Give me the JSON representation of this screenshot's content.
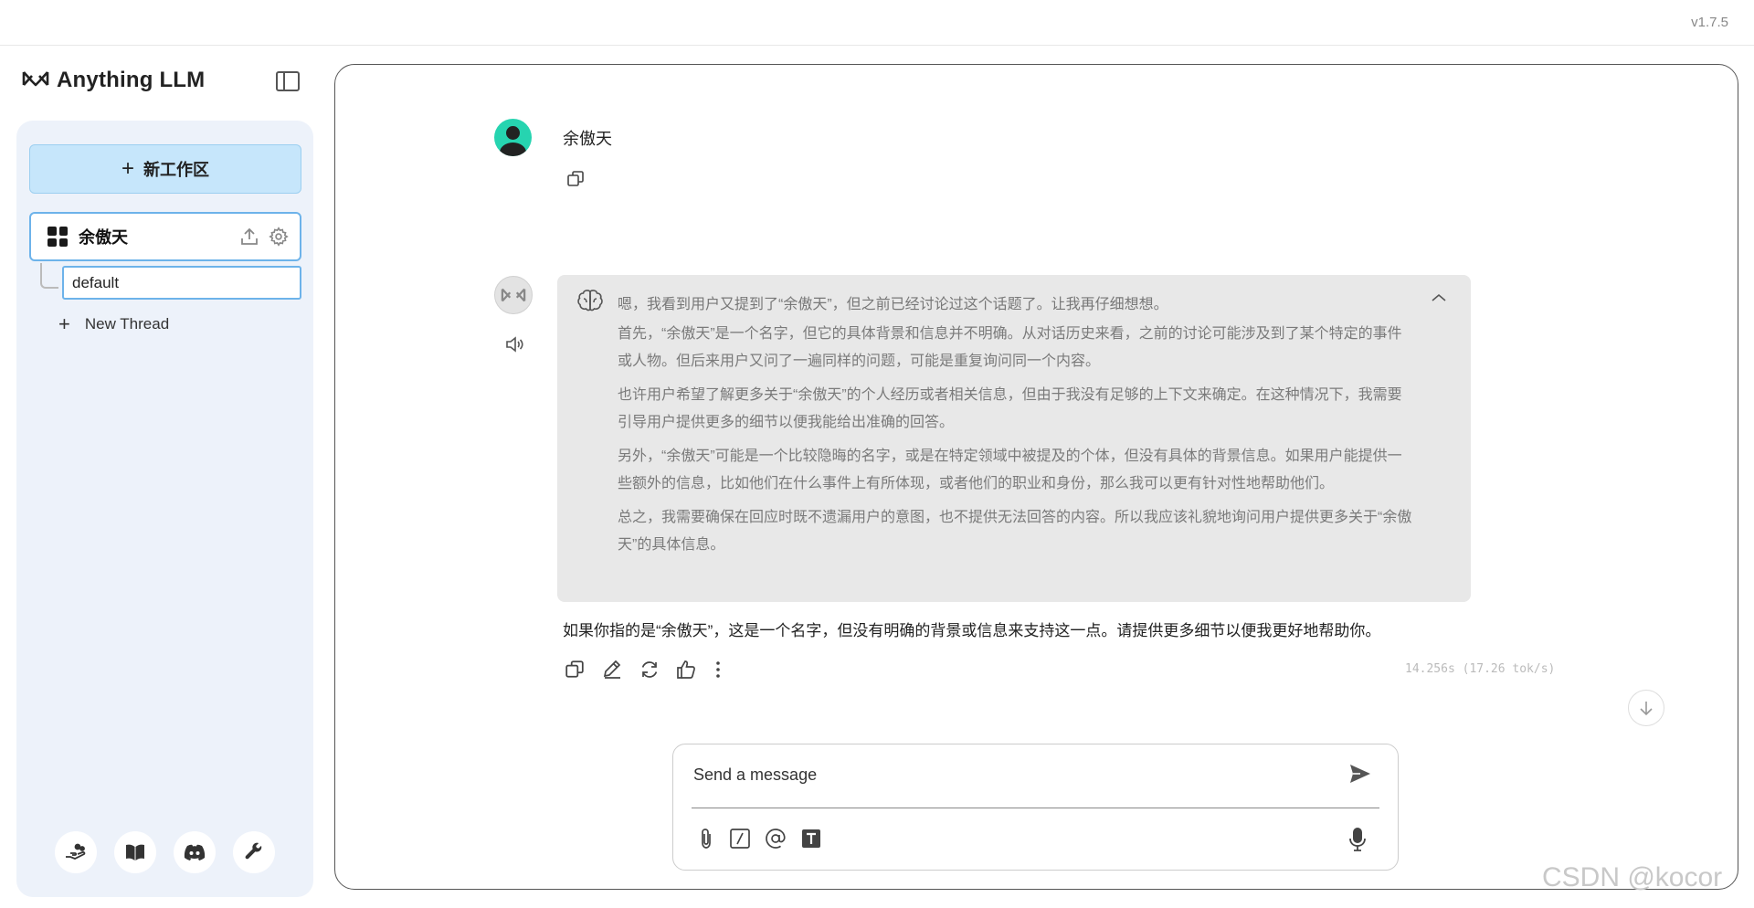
{
  "app": {
    "version": "v1.7.5",
    "brand_name": "Anything LLM"
  },
  "sidebar": {
    "new_workspace_label": "新工作区",
    "workspace": {
      "name": "余傲天",
      "threads": [
        {
          "label": "default",
          "selected": true
        }
      ]
    },
    "new_thread_label": "New Thread",
    "footer_icons": [
      "community-hub-icon",
      "docs-book-icon",
      "discord-icon",
      "settings-wrench-icon"
    ]
  },
  "chat": {
    "user_message": "余傲天",
    "thought_first_line": "嗯，我看到用户又提到了“余傲天”，但之前已经讨论过这个话题了。让我再仔细想想。",
    "thought_paragraphs": [
      "首先，“余傲天”是一个名字，但它的具体背景和信息并不明确。从对话历史来看，之前的讨论可能涉及到了某个特定的事件或人物。但后来用户又问了一遍同样的问题，可能是重复询问同一个内容。",
      "也许用户希望了解更多关于“余傲天”的个人经历或者相关信息，但由于我没有足够的上下文来确定。在这种情况下，我需要引导用户提供更多的细节以便我能给出准确的回答。",
      "另外，“余傲天”可能是一个比较隐晦的名字，或是在特定领域中被提及的个体，但没有具体的背景信息。如果用户能提供一些额外的信息，比如他们在什么事件上有所体现，或者他们的职业和身份，那么我可以更有针对性地帮助他们。",
      "总之，我需要确保在回应时既不遗漏用户的意图，也不提供无法回答的内容。所以我应该礼貌地询问用户提供更多关于“余傲天”的具体信息。"
    ],
    "answer": "如果你指的是“余傲天”，这是一个名字，但没有明确的背景或信息来支持这一点。请提供更多细节以便我更好地帮助你。",
    "timing": "14.256s (17.26 tok/s)"
  },
  "composer": {
    "placeholder": "Send a message"
  },
  "watermark": "CSDN @kocor",
  "colors": {
    "accent_blue": "#c6e6fb",
    "selected_border": "#6db3ea",
    "avatar_green": "#26d4b0",
    "thought_bg": "#e8e8e8"
  }
}
